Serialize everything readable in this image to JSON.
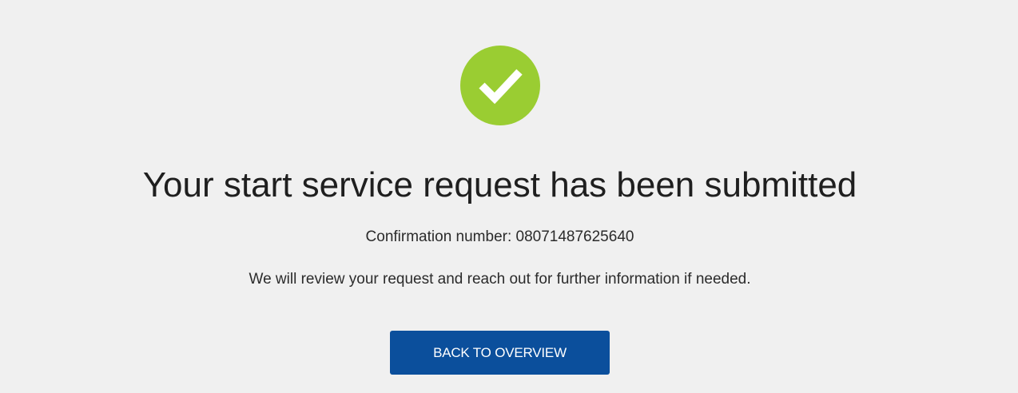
{
  "status": {
    "icon": "checkmark-circle-icon",
    "icon_color": "#9acd32"
  },
  "title": "Your start service request has been submitted",
  "confirmation": {
    "label": "Confirmation number: 08071487625640"
  },
  "message": "We will review your request and reach out for further information if needed.",
  "actions": {
    "back_label": "BACK TO OVERVIEW",
    "button_color": "#0b4f9c"
  }
}
